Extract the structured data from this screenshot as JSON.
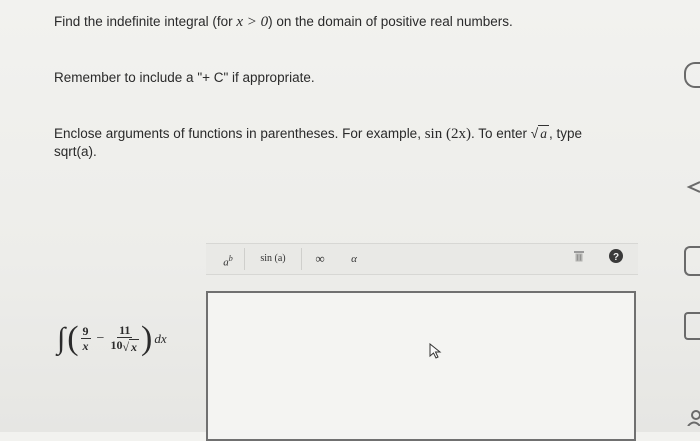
{
  "instructions": {
    "line1_prefix": "Find the indefinite integral (for",
    "line1_math": "x > 0",
    "line1_suffix": ") on the domain of positive real numbers.",
    "line2": "Remember to include a \"+ C\" if appropriate.",
    "line3_prefix": "Enclose arguments of functions in parentheses. For example,",
    "line3_example": "sin (2x)",
    "line3_mid": ". To enter",
    "line3_sqrt_arg": "a",
    "line3_suffix": ", type",
    "line4": "sqrt(a)."
  },
  "integral": {
    "frac1_num": "9",
    "frac1_den": "x",
    "frac2_num": "11",
    "frac2_den_coeff": "10",
    "frac2_den_var": "x",
    "dx": "dx"
  },
  "toolbar": {
    "power_label": "a",
    "power_sup": "b",
    "sin_label": "sin (a)",
    "infinity_label": "∞",
    "alpha_label": "α"
  },
  "colors": {
    "page_bg": "#eeeeeb",
    "answer_border": "#707070",
    "help_icon": "#3a3a3a"
  },
  "icons": [
    "trash-icon",
    "help-icon",
    "cursor-arrow-icon"
  ]
}
